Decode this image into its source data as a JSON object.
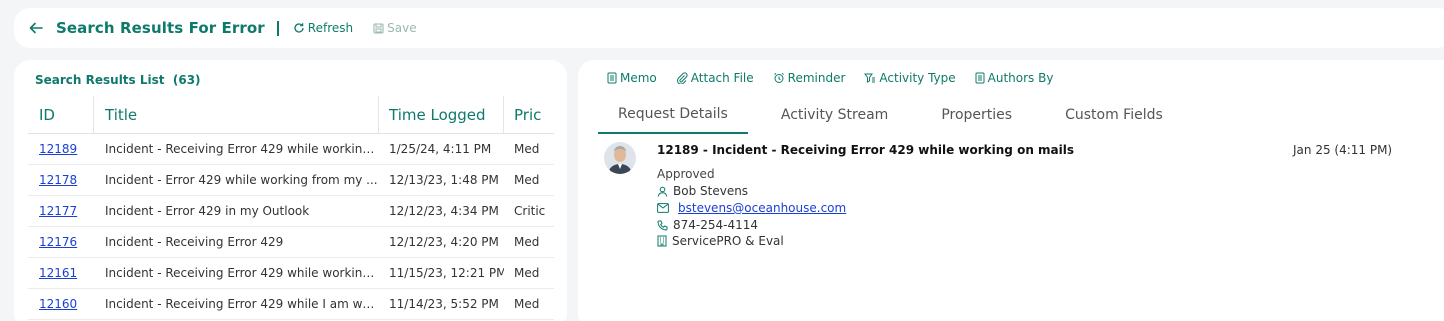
{
  "header": {
    "title": "Search Results For Error",
    "refresh_label": "Refresh",
    "save_label": "Save"
  },
  "results": {
    "title": "Search Results List",
    "count": "(63)",
    "columns": [
      "ID",
      "Title",
      "Time Logged",
      "Pric"
    ],
    "rows": [
      {
        "id": "12189",
        "title": "Incident - Receiving Error 429 while working ...",
        "time": "1/25/24, 4:11 PM",
        "priority": "Med"
      },
      {
        "id": "12178",
        "title": "Incident - Error 429 while working from my ...",
        "time": "12/13/23, 1:48 PM",
        "priority": "Med"
      },
      {
        "id": "12177",
        "title": "Incident - Error 429 in my Outlook",
        "time": "12/12/23, 4:34 PM",
        "priority": "Critic"
      },
      {
        "id": "12176",
        "title": "Incident - Receiving Error 429",
        "time": "12/12/23, 4:20 PM",
        "priority": "Med"
      },
      {
        "id": "12161",
        "title": "Incident - Receiving Error 429 while working ...",
        "time": "11/15/23, 12:21 PM",
        "priority": "Med"
      },
      {
        "id": "12160",
        "title": "Incident - Receiving Error 429 while I am wo...",
        "time": "11/14/23, 5:52 PM",
        "priority": "Med"
      }
    ]
  },
  "actions": {
    "memo": "Memo",
    "attach": "Attach File",
    "reminder": "Reminder",
    "activity_type": "Activity Type",
    "authors_by": "Authors By"
  },
  "tabs": [
    "Request Details",
    "Activity Stream",
    "Properties",
    "Custom Fields"
  ],
  "detail": {
    "heading": "12189 - Incident - Receiving Error 429 while working on mails",
    "date": "Jan 25 (4:11 PM)",
    "status": "Approved",
    "name": "Bob Stevens",
    "email": "bstevens@oceanhouse.com",
    "phone": "874-254-4114",
    "company": "ServicePRO & Eval"
  },
  "colors": {
    "accent": "#0f7a6b",
    "link": "#1a3fd6"
  }
}
